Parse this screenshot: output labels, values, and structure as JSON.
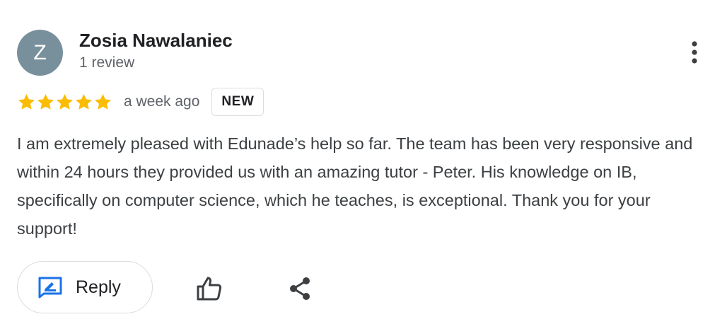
{
  "review": {
    "author": {
      "avatar_letter": "Z",
      "avatar_color": "#78909c",
      "name": "Zosia Nawalaniec",
      "review_count": "1 review"
    },
    "rating": 5,
    "star_color": "#fbbc04",
    "time_ago": "a week ago",
    "badge": "NEW",
    "text": "I am extremely pleased with Edunade’s help so far. The team has been very responsive and within 24 hours they provided us with an amazing tutor - Peter. His knowledge on IB, specifically on computer science, which he teaches, is exceptional. Thank you for your support!",
    "menu_icon": "more-vert-icon"
  },
  "actions": {
    "reply_label": "Reply",
    "reply_icon": "reply-edit-icon",
    "reply_icon_color": "#1a73e8",
    "like_icon": "thumb-up-icon",
    "share_icon": "share-icon"
  }
}
